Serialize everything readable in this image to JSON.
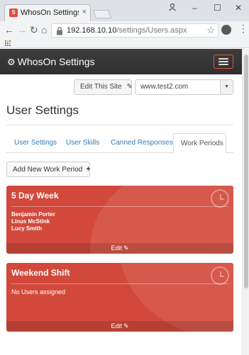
{
  "browser": {
    "tab_title": "WhosOn Settings | User ",
    "tab_favicon": "S",
    "tab_close": "×",
    "url_host": "192.168.10.10",
    "url_path": "/settings/Users.aspx",
    "icons": {
      "back": "←",
      "forward": "→",
      "reload": "↻",
      "home": "⌂",
      "star": "☆",
      "menu": "⋮",
      "minimize": "–",
      "maximize": "☐",
      "close": "✕"
    },
    "apps_colors": [
      "#ea4335",
      "#fbbc05",
      "#34a853",
      "#4285f4",
      "#ea4335",
      "#fbbc05",
      "#34a853",
      "#4285f4",
      "#ea4335"
    ]
  },
  "navbar": {
    "brand_icon": "⚙",
    "brand": "WhosOn Settings",
    "accent": "#e8553c"
  },
  "site_bar": {
    "edit_label": "Edit This Site",
    "edit_icon": "✎",
    "site_value": "www.test2.com",
    "caret": "▼"
  },
  "page_title": "User Settings",
  "tabs": [
    {
      "label": "User Settings",
      "active": false
    },
    {
      "label": "User Skills",
      "active": false
    },
    {
      "label": "Canned Responses",
      "active": false
    },
    {
      "label": "Work Periods",
      "active": true
    }
  ],
  "add_button": {
    "label": "Add New Work Period",
    "icon": "+"
  },
  "work_periods": [
    {
      "name": "5 Day Week",
      "users": [
        "Benjamin Porter",
        "Linus McStink",
        "Lucy Smith"
      ],
      "edit_label": "Edit",
      "edit_icon": "✎"
    },
    {
      "name": "Weekend Shift",
      "empty_text": "No Users assigned",
      "edit_label": "Edit",
      "edit_icon": "✎"
    }
  ],
  "colors": {
    "card": "#d2493b",
    "link": "#337ab7"
  }
}
